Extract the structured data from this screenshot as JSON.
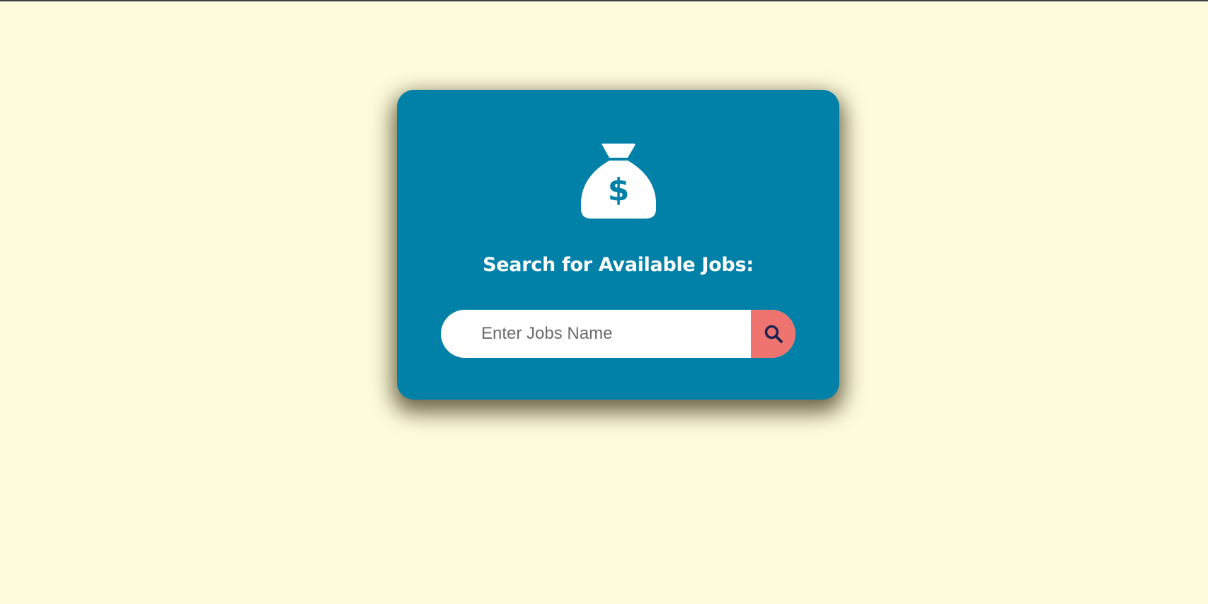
{
  "colors": {
    "page_background": "#fdfbdc",
    "card_background": "#0281a8",
    "search_button": "#ef7470",
    "search_icon": "#1c2452",
    "text": "#ffffff"
  },
  "card": {
    "icon": "money-bag-icon",
    "heading": "Search for Available Jobs:"
  },
  "search": {
    "placeholder": "Enter Jobs Name",
    "value": "",
    "button_icon": "search-icon"
  }
}
